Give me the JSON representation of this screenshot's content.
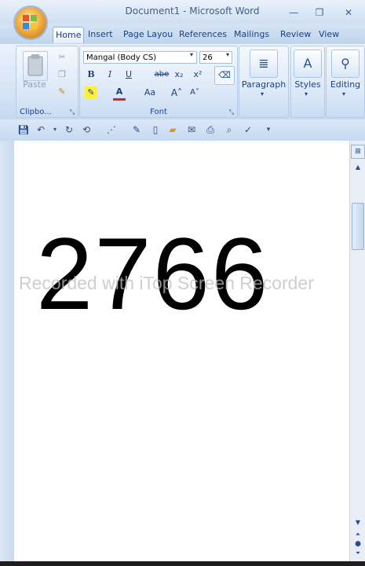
{
  "window": {
    "title": "Document1 - Microsoft Word",
    "minimize": "—",
    "restore": "❐",
    "close": "✕"
  },
  "tabs": [
    "Home",
    "Insert",
    "Page Layou",
    "References",
    "Mailings",
    "Review",
    "View"
  ],
  "ribbon": {
    "clipboard": {
      "paste_label": "Paste",
      "group_label": "Clipbo..."
    },
    "font": {
      "font_name": "Mangal (Body CS)",
      "font_size": "26",
      "bold": "B",
      "italic": "I",
      "underline": "U",
      "strike": "abe",
      "subscript": "x₂",
      "superscript": "x²",
      "font_color": "A",
      "change_case": "Aa",
      "grow": "A˄",
      "shrink": "A˅",
      "group_label": "Font"
    },
    "paragraph_label": "Paragraph",
    "styles_label": "Styles",
    "editing_label": "Editing"
  },
  "document": {
    "text": "2766"
  },
  "watermark": "Recorded with iTop Screen Recorder",
  "colors": {
    "accent": "#15428b",
    "ribbon_bg": "#d3e2f5"
  }
}
